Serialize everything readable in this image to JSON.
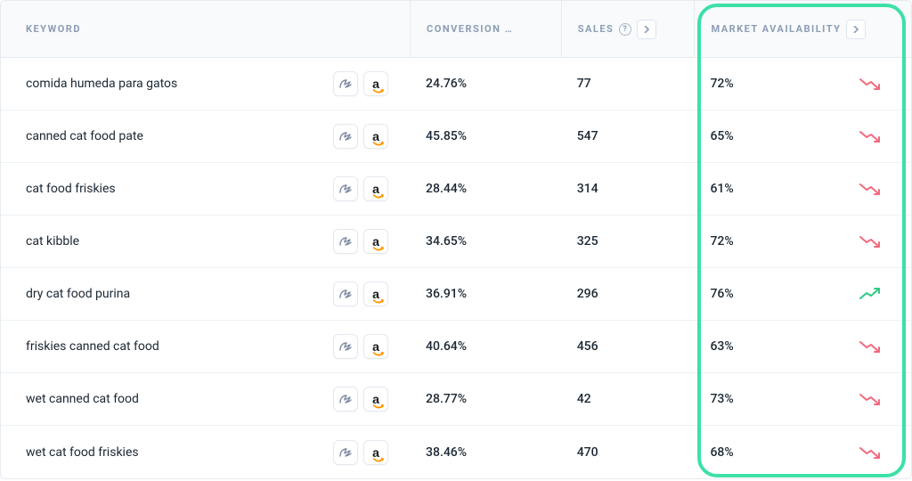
{
  "columns": {
    "keyword": "Keyword",
    "conversion": "Conversion …",
    "sales": "Sales",
    "availability": "Market Availability"
  },
  "rows": [
    {
      "keyword": "comida humeda para gatos",
      "conversion": "24.76%",
      "sales": "77",
      "availability": "72%",
      "trend": "down"
    },
    {
      "keyword": "canned cat food pate",
      "conversion": "45.85%",
      "sales": "547",
      "availability": "65%",
      "trend": "down"
    },
    {
      "keyword": "cat food friskies",
      "conversion": "28.44%",
      "sales": "314",
      "availability": "61%",
      "trend": "down"
    },
    {
      "keyword": "cat kibble",
      "conversion": "34.65%",
      "sales": "325",
      "availability": "72%",
      "trend": "down"
    },
    {
      "keyword": "dry cat food purina",
      "conversion": "36.91%",
      "sales": "296",
      "availability": "76%",
      "trend": "up"
    },
    {
      "keyword": "friskies canned cat food",
      "conversion": "40.64%",
      "sales": "456",
      "availability": "63%",
      "trend": "down"
    },
    {
      "keyword": "wet canned cat food",
      "conversion": "28.77%",
      "sales": "42",
      "availability": "73%",
      "trend": "down"
    },
    {
      "keyword": "wet cat food friskies",
      "conversion": "38.46%",
      "sales": "470",
      "availability": "68%",
      "trend": "down"
    }
  ],
  "colors": {
    "trend_down": "#f26a7e",
    "trend_up": "#2ecb87",
    "highlight": "#3de0a7"
  }
}
